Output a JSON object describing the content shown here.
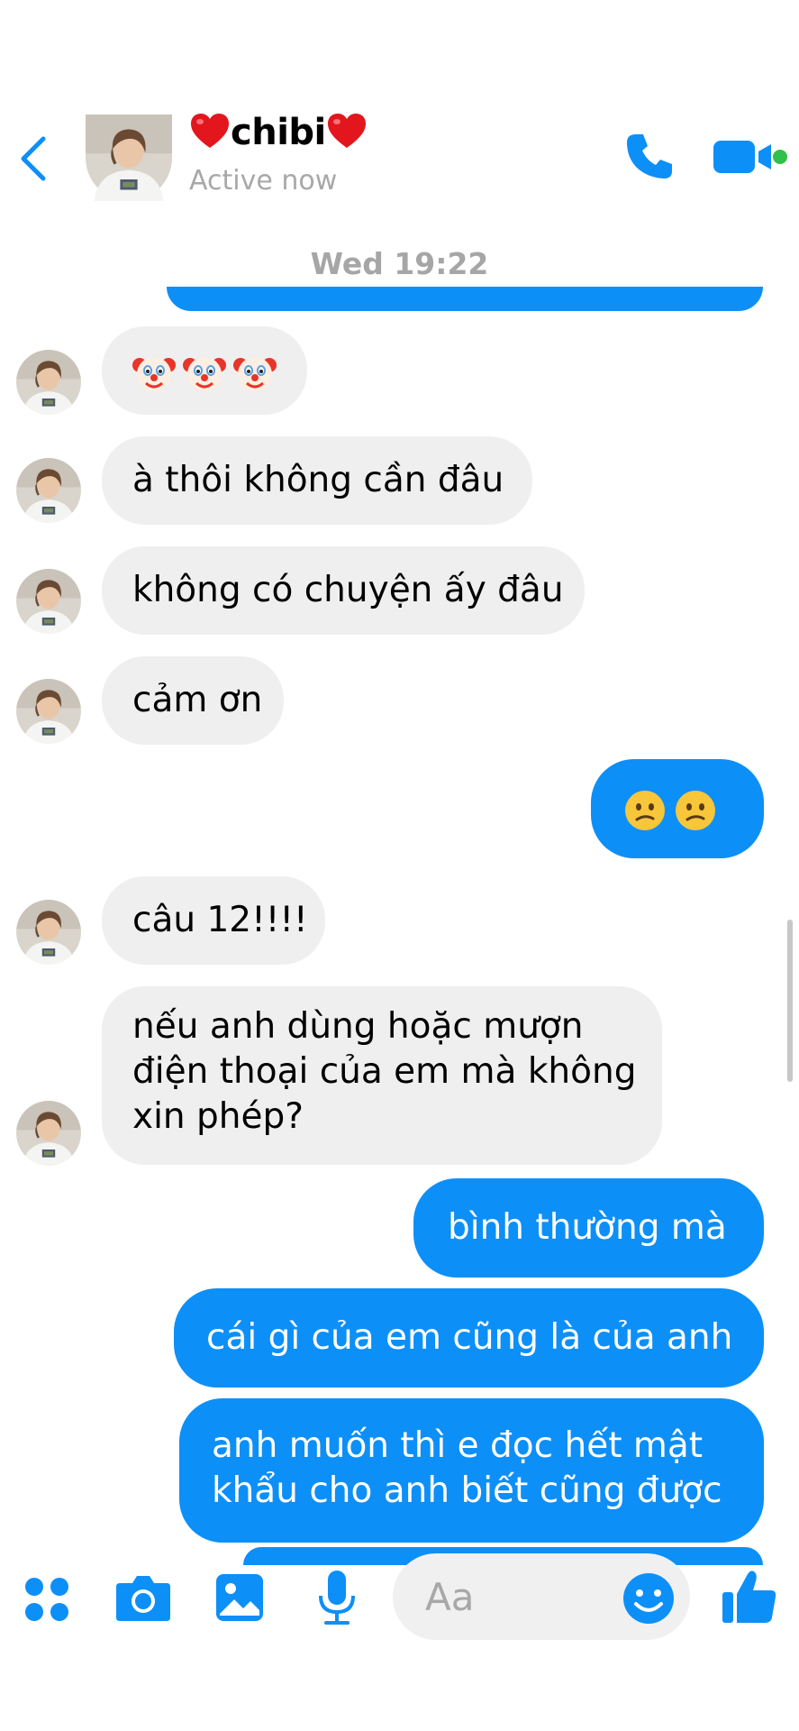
{
  "header": {
    "contact_name": "chibi",
    "status": "Active now"
  },
  "chat": {
    "timestamp": "Wed 19:22",
    "messages": [
      {
        "direction": "incoming",
        "text": "🤡🤡🤡"
      },
      {
        "direction": "incoming",
        "text": "à thôi không cần đâu"
      },
      {
        "direction": "incoming",
        "text": "không có chuyện ấy đâu"
      },
      {
        "direction": "incoming",
        "text": "cảm ơn"
      },
      {
        "direction": "outgoing",
        "text": "😕😕"
      },
      {
        "direction": "incoming",
        "text": "câu 12!!!!"
      },
      {
        "direction": "incoming",
        "lines": [
          "nếu anh dùng hoặc mượn",
          "điện thoại của em mà không",
          "xin phép?"
        ]
      },
      {
        "direction": "outgoing",
        "text": "bình thường mà"
      },
      {
        "direction": "outgoing",
        "text": "cái gì của em cũng là của anh"
      },
      {
        "direction": "outgoing",
        "lines": [
          "anh muốn thì e đọc hết mật",
          "khẩu cho anh biết cũng được"
        ]
      }
    ]
  },
  "composer": {
    "placeholder": "Aa",
    "tools": [
      "apps-icon",
      "camera-icon",
      "gallery-icon",
      "microphone-icon",
      "emoji-icon",
      "thumbs-up-icon"
    ]
  },
  "colors": {
    "accent": "#0d8ff8",
    "incoming_bubble": "#efefef",
    "muted_text": "#a6a6a6",
    "online": "#31c04a"
  }
}
